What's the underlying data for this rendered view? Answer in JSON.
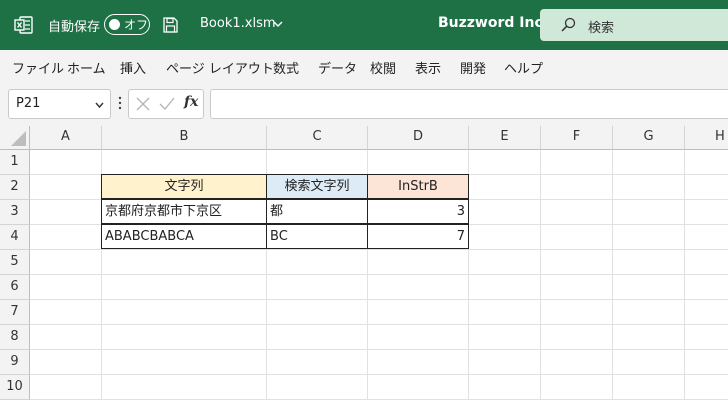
{
  "titlebar": {
    "autosave_label": "自動保存",
    "autosave_state": "オフ",
    "filename": "Book1.xlsm",
    "company": "Buzzword Inc.",
    "search_placeholder": "検索",
    "bg_color": "#1e7145"
  },
  "menu": [
    "ファイル",
    "ホーム",
    "挿入",
    "ページ レイアウト",
    "数式",
    "データ",
    "校閲",
    "表示",
    "開発",
    "ヘルプ"
  ],
  "formula_bar": {
    "name_box": "P21",
    "fx_label": "fx",
    "formula": ""
  },
  "columns": [
    "A",
    "B",
    "C",
    "D",
    "E",
    "F",
    "G",
    "H"
  ],
  "rows": [
    "1",
    "2",
    "3",
    "4",
    "5",
    "6",
    "7",
    "8",
    "9",
    "10"
  ],
  "table": {
    "headers": [
      {
        "text": "文字列",
        "bg": "#fff2cc"
      },
      {
        "text": "検索文字列",
        "bg": "#ddebf7"
      },
      {
        "text": "InStrB",
        "bg": "#fce4d6"
      }
    ],
    "rows": [
      [
        "京都府京都市下京区",
        "都",
        "3"
      ],
      [
        "ABABCBABCA",
        "BC",
        "7"
      ]
    ]
  }
}
